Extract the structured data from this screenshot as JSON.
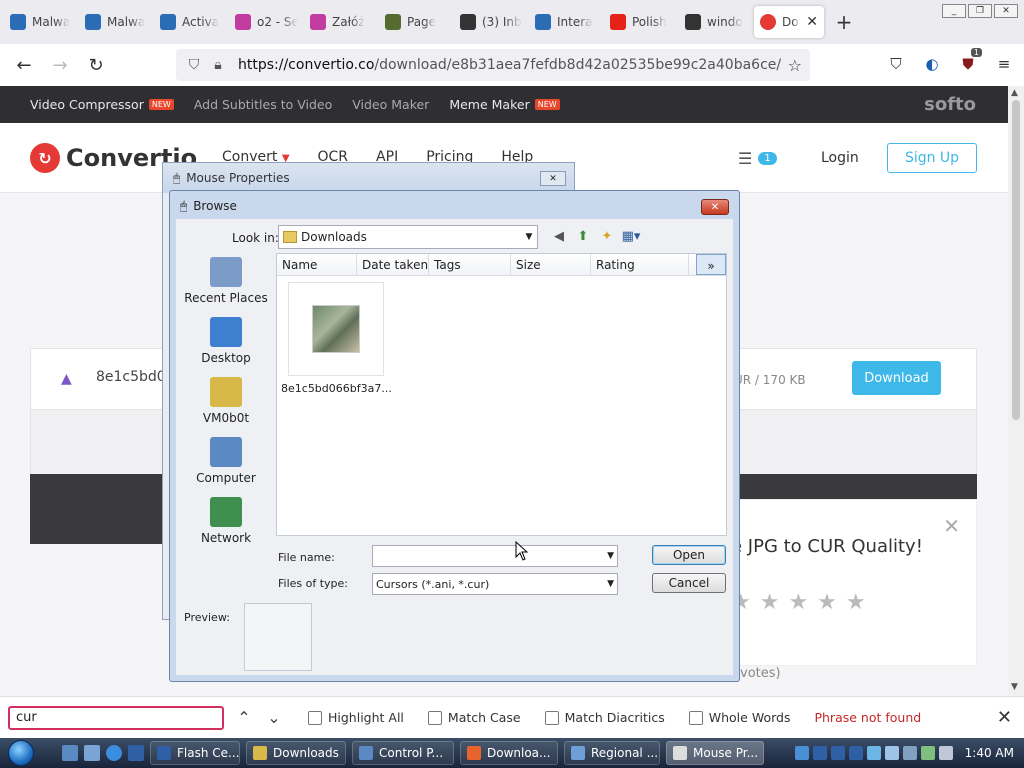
{
  "browser": {
    "tabs": [
      {
        "label": "Malwa",
        "color": "#2a6db5"
      },
      {
        "label": "Malwa",
        "color": "#2a6db5"
      },
      {
        "label": "Activa",
        "color": "#2a6db5"
      },
      {
        "label": "o2 - Se",
        "color": "#c23ba0"
      },
      {
        "label": "Załóż",
        "color": "#c23ba0"
      },
      {
        "label": "Page",
        "color": "#556b2f"
      },
      {
        "label": "(3) Inb",
        "color": "#333333"
      },
      {
        "label": "Intera",
        "color": "#2a6db5"
      },
      {
        "label": "Polish",
        "color": "#e62117"
      },
      {
        "label": "windo",
        "color": "#333333"
      }
    ],
    "active_tab": {
      "label": "Dov",
      "color": "#e53935"
    },
    "url_host": "https://convertio.co",
    "url_path": "/download/e8b31aea7fefdb8d42a02535be99c2a40ba6ce/",
    "ext_badge": "1"
  },
  "site": {
    "topstrip": [
      {
        "label": "Video Compressor",
        "badge": "NEW",
        "dim": false
      },
      {
        "label": "Add Subtitles to Video",
        "badge": "",
        "dim": true
      },
      {
        "label": "Video Maker",
        "badge": "",
        "dim": true
      },
      {
        "label": "Meme Maker",
        "badge": "NEW",
        "dim": false
      }
    ],
    "softo": "softo",
    "logo_text": "Convertio",
    "menu": [
      "Convert",
      "OCR",
      "API",
      "Pricing",
      "Help"
    ],
    "layers_count": "1",
    "login": "Login",
    "signup": "Sign Up",
    "file_name": "8e1c5bd0",
    "file_meta": "UR / 170 KB",
    "download": "Download",
    "rate_title": "e JPG to CUR Quality!",
    "stars": "★★★★★",
    "votes": "votes)"
  },
  "mouse_props": {
    "title": "Mouse Properties"
  },
  "browse": {
    "title": "Browse",
    "look_in_label": "Look in:",
    "look_in_value": "Downloads",
    "places": [
      {
        "label": "Recent Places",
        "color": "#7a9cc6"
      },
      {
        "label": "Desktop",
        "color": "#3f7fd0"
      },
      {
        "label": "VM0b0t",
        "color": "#d9b84a"
      },
      {
        "label": "Computer",
        "color": "#5b89c4"
      },
      {
        "label": "Network",
        "color": "#3f8f4f"
      }
    ],
    "columns": [
      "Name",
      "Date taken",
      "Tags",
      "Size",
      "Rating"
    ],
    "more": "»",
    "file_label": "8e1c5bd066bf3a7...",
    "file_name_label": "File name:",
    "file_name_value": "",
    "files_of_type_label": "Files of type:",
    "files_of_type_value": "Cursors (*.ani, *.cur)",
    "open": "Open",
    "cancel": "Cancel",
    "preview": "Preview:"
  },
  "findbar": {
    "query": "cur",
    "highlight_all": "Highlight All",
    "match_case": "Match Case",
    "match_diacritics": "Match Diacritics",
    "whole_words": "Whole Words",
    "status": "Phrase not found"
  },
  "taskbar": {
    "buttons": [
      {
        "label": "Flash Ce...",
        "color": "#2f5fa5",
        "active": false
      },
      {
        "label": "Downloads",
        "color": "#d9b84a",
        "active": false
      },
      {
        "label": "Control P...",
        "color": "#5b89c4",
        "active": false
      },
      {
        "label": "Downloa...",
        "color": "#e8622c",
        "active": false
      },
      {
        "label": "Regional ...",
        "color": "#6f9fd8",
        "active": false
      },
      {
        "label": "Mouse Pr...",
        "color": "#dddddd",
        "active": true
      }
    ],
    "clock": "1:40 AM"
  }
}
